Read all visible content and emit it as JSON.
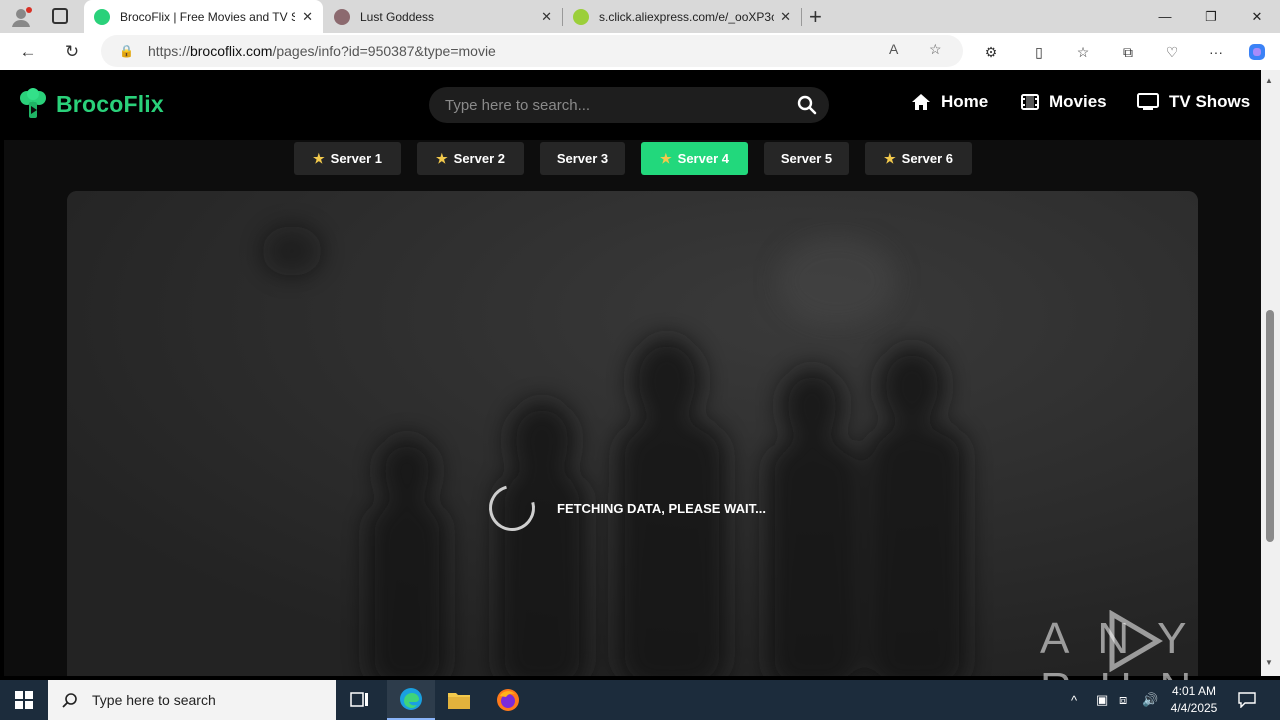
{
  "browser": {
    "tabs": [
      {
        "title": "BrocoFlix | Free Movies and TV Sh",
        "active": true
      },
      {
        "title": "Lust Goddess",
        "active": false
      },
      {
        "title": "s.click.aliexpress.com/e/_ooXP3c",
        "active": false
      }
    ],
    "url_prefix": "https://",
    "url_host": "brocoflix.com",
    "url_path": "/pages/info?id=950387&type=movie"
  },
  "site": {
    "logo_text": "BrocoFlix",
    "search_placeholder": "Type here to search...",
    "nav": [
      {
        "label": "Home",
        "icon": "home-icon"
      },
      {
        "label": "Movies",
        "icon": "film-icon"
      },
      {
        "label": "TV Shows",
        "icon": "tv-icon"
      }
    ],
    "servers": [
      {
        "label": "Server 1",
        "starred": true,
        "active": false
      },
      {
        "label": "Server 2",
        "starred": true,
        "active": false
      },
      {
        "label": "Server 3",
        "starred": false,
        "active": false
      },
      {
        "label": "Server 4",
        "starred": true,
        "active": true
      },
      {
        "label": "Server 5",
        "starred": false,
        "active": false
      },
      {
        "label": "Server 6",
        "starred": true,
        "active": false
      }
    ],
    "loading_text": "FETCHING DATA, PLEASE WAIT...",
    "accent_color": "#22d87c"
  },
  "watermark": "ANY RUN",
  "taskbar": {
    "search_placeholder": "Type here to search",
    "time": "4:01 AM",
    "date": "4/4/2025"
  }
}
